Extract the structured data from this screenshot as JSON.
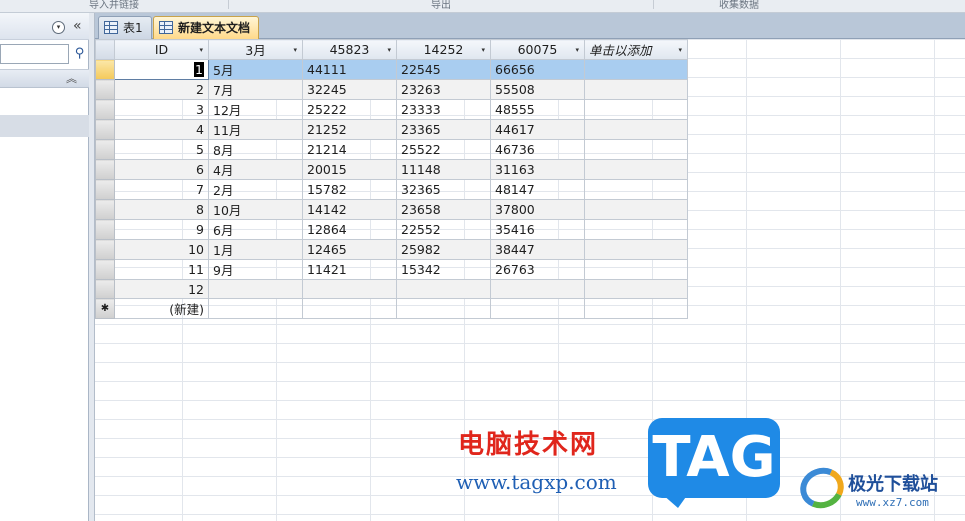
{
  "ribbon": {
    "groups": [
      "导入并链接",
      "导出",
      "收集数据"
    ]
  },
  "nav": {
    "dropdown_glyph": "▾",
    "collapse_glyph": "«",
    "search_placeholder": "",
    "search_icon_glyph": "⚲",
    "group_chevron_glyph": "︽"
  },
  "tabs": [
    {
      "label": "表1",
      "active": false
    },
    {
      "label": "新建文本文档",
      "active": true
    }
  ],
  "table": {
    "columns": [
      "ID",
      "3月",
      "45823",
      "14252",
      "60075",
      "单击以添加"
    ],
    "dropdown_glyph": "▾",
    "rows": [
      {
        "id": "1",
        "c1": "5月",
        "c2": "44111",
        "c3": "22545",
        "c4": "66656"
      },
      {
        "id": "2",
        "c1": "7月",
        "c2": "32245",
        "c3": "23263",
        "c4": "55508"
      },
      {
        "id": "3",
        "c1": "12月",
        "c2": "25222",
        "c3": "23333",
        "c4": "48555"
      },
      {
        "id": "4",
        "c1": "11月",
        "c2": "21252",
        "c3": "23365",
        "c4": "44617"
      },
      {
        "id": "5",
        "c1": "8月",
        "c2": "21214",
        "c3": "25522",
        "c4": "46736"
      },
      {
        "id": "6",
        "c1": "4月",
        "c2": "20015",
        "c3": "11148",
        "c4": "31163"
      },
      {
        "id": "7",
        "c1": "2月",
        "c2": "15782",
        "c3": "32365",
        "c4": "48147"
      },
      {
        "id": "8",
        "c1": "10月",
        "c2": "14142",
        "c3": "23658",
        "c4": "37800"
      },
      {
        "id": "9",
        "c1": "6月",
        "c2": "12864",
        "c3": "22552",
        "c4": "35416"
      },
      {
        "id": "10",
        "c1": "1月",
        "c2": "12465",
        "c3": "25982",
        "c4": "38447"
      },
      {
        "id": "11",
        "c1": "9月",
        "c2": "11421",
        "c3": "15342",
        "c4": "26763"
      },
      {
        "id": "12",
        "c1": "",
        "c2": "",
        "c3": "",
        "c4": ""
      }
    ],
    "new_row_marker": "✱",
    "new_row_label": "(新建)"
  },
  "watermark": {
    "site_cn": "电脑技术网",
    "site_url": "www.tagxp.com",
    "tag": "TAG",
    "logo_cn": "极光下载站",
    "logo_url": "www.xz7.com"
  },
  "colors": {
    "current_row": "#a9cdf0",
    "selector_active": "#f4c95a",
    "tab_active": "#ffd98a",
    "watermark_red": "#e0261c",
    "watermark_blue": "#1f8ae6"
  }
}
